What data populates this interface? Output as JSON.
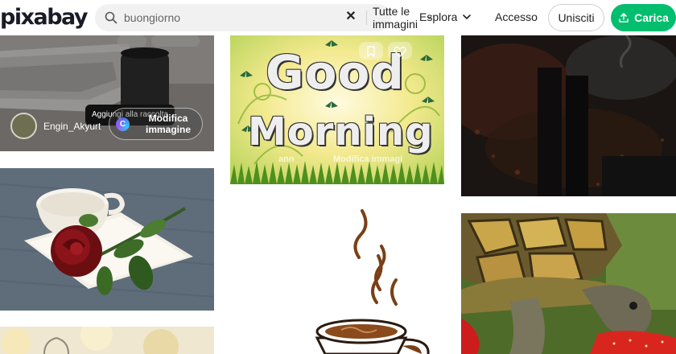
{
  "brand": {
    "logo": "pixabay"
  },
  "search": {
    "query": "buongiorno",
    "type_label": "Tutte le immagini"
  },
  "nav": {
    "explore": "Esplora",
    "login": "Accesso",
    "join": "Unisciti",
    "upload": "Carica"
  },
  "colors": {
    "accent_green": "#02be6e",
    "search_bg": "#f1f1f1",
    "tooltip_bg": "#111111"
  },
  "images": {
    "laptop": {
      "tooltip": "Aggiungi alla raccolta",
      "user": "Engin_Akyurt",
      "edit": "Modifica immagine"
    },
    "good_morning": {
      "line1": "Good",
      "line2": "Morning",
      "ghost_user": "ann",
      "ghost_edit": "Modifica immagi"
    }
  },
  "icons": [
    "search-icon",
    "close-icon",
    "chevron-down-icon",
    "upload-icon",
    "canva-icon",
    "heart-icon",
    "bookmark-icon"
  ]
}
